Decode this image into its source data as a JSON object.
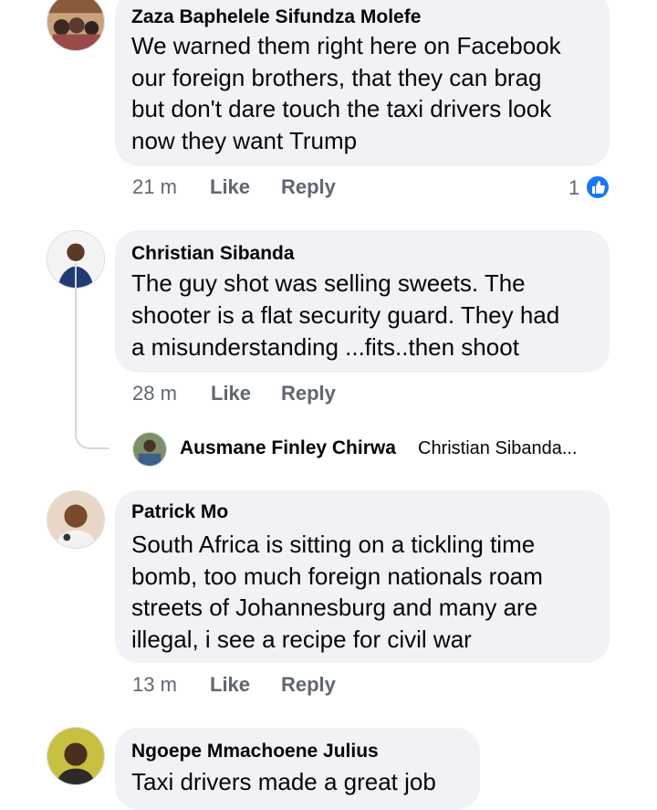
{
  "comments": [
    {
      "author": "Zaza Baphelele Sifundza Molefe",
      "lines": [
        "We warned them right here on Facebook",
        "our foreign brothers, that they can brag",
        "but don't dare touch the taxi drivers look",
        "now they want Trump"
      ],
      "time": "21 m",
      "like_label": "Like",
      "reply_label": "Reply",
      "reaction_count": "1"
    },
    {
      "author": "Christian Sibanda",
      "lines": [
        "The guy shot was selling sweets. The",
        "shooter is a flat security guard. They had",
        "a misunderstanding ...fits..then shoot"
      ],
      "time": "28 m",
      "like_label": "Like",
      "reply_label": "Reply",
      "reply_preview": {
        "author": "Ausmane Finley Chirwa",
        "text": "Christian Sibanda..."
      }
    },
    {
      "author": "Patrick Mo",
      "lines": [
        "South Africa is sitting on a tickling time",
        "bomb, too much foreign nationals roam",
        "streets of Johannesburg and many are",
        "illegal, i see a recipe for civil war"
      ],
      "time": "13 m",
      "like_label": "Like",
      "reply_label": "Reply"
    },
    {
      "author": "Ngoepe Mmachoene Julius",
      "lines": [
        "Taxi drivers made a great job"
      ]
    }
  ],
  "colors": {
    "bubble": "#f0f2f5",
    "meta": "#606770",
    "like_blue": "#1877f2"
  }
}
